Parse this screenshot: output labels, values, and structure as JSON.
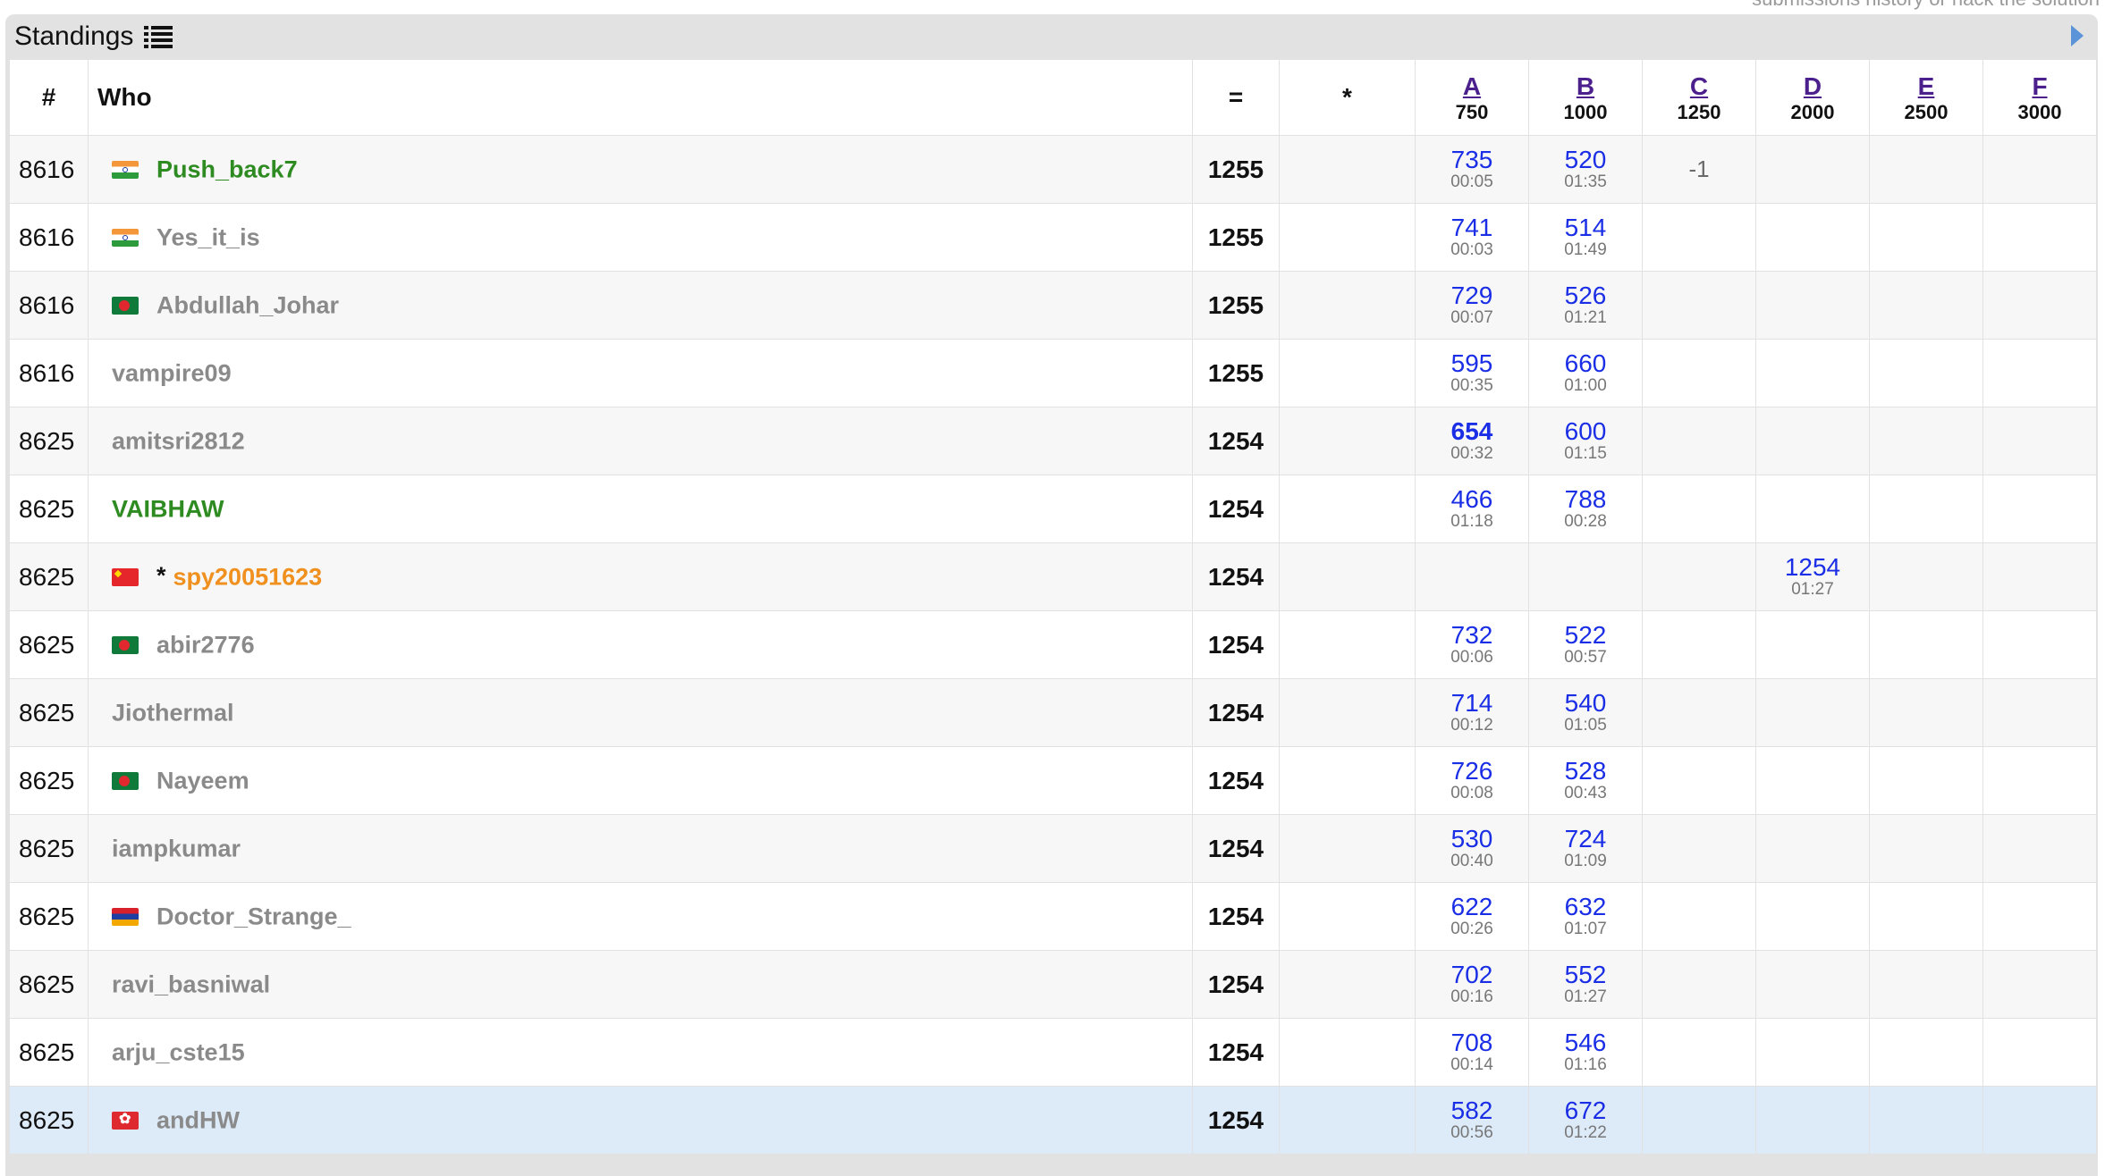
{
  "top_note": "submissions history or hack the solution",
  "panel": {
    "title": "Standings"
  },
  "header": {
    "rank": "#",
    "who": "Who",
    "score": "=",
    "hacks": "*",
    "problems": [
      {
        "letter": "A",
        "points": "750"
      },
      {
        "letter": "B",
        "points": "1000"
      },
      {
        "letter": "C",
        "points": "1250"
      },
      {
        "letter": "D",
        "points": "2000"
      },
      {
        "letter": "E",
        "points": "2500"
      },
      {
        "letter": "F",
        "points": "3000"
      }
    ]
  },
  "rows": [
    {
      "rank": "8616",
      "flag": "in",
      "name": "Push_back7",
      "color": "green",
      "star": "",
      "score": "1255",
      "A": {
        "p": "735",
        "t": "00:05"
      },
      "B": {
        "p": "520",
        "t": "01:35"
      },
      "C": {
        "neg": "-1"
      }
    },
    {
      "rank": "8616",
      "flag": "in",
      "name": "Yes_it_is",
      "color": "gray",
      "star": "",
      "score": "1255",
      "A": {
        "p": "741",
        "t": "00:03"
      },
      "B": {
        "p": "514",
        "t": "01:49"
      }
    },
    {
      "rank": "8616",
      "flag": "bd",
      "name": "Abdullah_Johar",
      "color": "gray",
      "star": "",
      "score": "1255",
      "A": {
        "p": "729",
        "t": "00:07"
      },
      "B": {
        "p": "526",
        "t": "01:21"
      }
    },
    {
      "rank": "8616",
      "flag": "",
      "name": "vampire09",
      "color": "gray",
      "star": "",
      "score": "1255",
      "A": {
        "p": "595",
        "t": "00:35"
      },
      "B": {
        "p": "660",
        "t": "01:00"
      }
    },
    {
      "rank": "8625",
      "flag": "",
      "name": "amitsri2812",
      "color": "gray",
      "star": "",
      "score": "1254",
      "A": {
        "p": "654",
        "t": "00:32",
        "bold": true
      },
      "B": {
        "p": "600",
        "t": "01:15"
      }
    },
    {
      "rank": "8625",
      "flag": "",
      "name": "VAIBHAW",
      "color": "green",
      "star": "",
      "score": "1254",
      "A": {
        "p": "466",
        "t": "01:18"
      },
      "B": {
        "p": "788",
        "t": "00:28"
      }
    },
    {
      "rank": "8625",
      "flag": "cn",
      "name": "spy20051623",
      "color": "orange",
      "star": "*",
      "score": "1254",
      "D": {
        "p": "1254",
        "t": "01:27"
      }
    },
    {
      "rank": "8625",
      "flag": "bd",
      "name": "abir2776",
      "color": "gray",
      "star": "",
      "score": "1254",
      "A": {
        "p": "732",
        "t": "00:06"
      },
      "B": {
        "p": "522",
        "t": "00:57"
      }
    },
    {
      "rank": "8625",
      "flag": "",
      "name": "Jiothermal",
      "color": "gray",
      "star": "",
      "score": "1254",
      "A": {
        "p": "714",
        "t": "00:12"
      },
      "B": {
        "p": "540",
        "t": "01:05"
      }
    },
    {
      "rank": "8625",
      "flag": "bd",
      "name": "Nayeem",
      "color": "gray",
      "star": "",
      "score": "1254",
      "A": {
        "p": "726",
        "t": "00:08"
      },
      "B": {
        "p": "528",
        "t": "00:43"
      }
    },
    {
      "rank": "8625",
      "flag": "",
      "name": "iampkumar",
      "color": "gray",
      "star": "",
      "score": "1254",
      "A": {
        "p": "530",
        "t": "00:40"
      },
      "B": {
        "p": "724",
        "t": "01:09"
      }
    },
    {
      "rank": "8625",
      "flag": "am",
      "name": "Doctor_Strange_",
      "color": "gray",
      "star": "",
      "score": "1254",
      "A": {
        "p": "622",
        "t": "00:26"
      },
      "B": {
        "p": "632",
        "t": "01:07"
      }
    },
    {
      "rank": "8625",
      "flag": "",
      "name": "ravi_basniwal",
      "color": "gray",
      "star": "",
      "score": "1254",
      "A": {
        "p": "702",
        "t": "00:16"
      },
      "B": {
        "p": "552",
        "t": "01:27"
      }
    },
    {
      "rank": "8625",
      "flag": "",
      "name": "arju_cste15",
      "color": "gray",
      "star": "",
      "score": "1254",
      "A": {
        "p": "708",
        "t": "00:14"
      },
      "B": {
        "p": "546",
        "t": "01:16"
      }
    },
    {
      "rank": "8625",
      "flag": "hk",
      "name": "andHW",
      "color": "gray",
      "star": "",
      "score": "1254",
      "A": {
        "p": "582",
        "t": "00:56"
      },
      "B": {
        "p": "672",
        "t": "01:22"
      },
      "highlight": true
    }
  ],
  "colors": {
    "accent_blue": "#1a2ee6",
    "handle_green": "#2e8b22",
    "handle_orange": "#f0901e",
    "handle_gray": "#8a8a8a",
    "highlight_row": "#ddeaf8"
  }
}
